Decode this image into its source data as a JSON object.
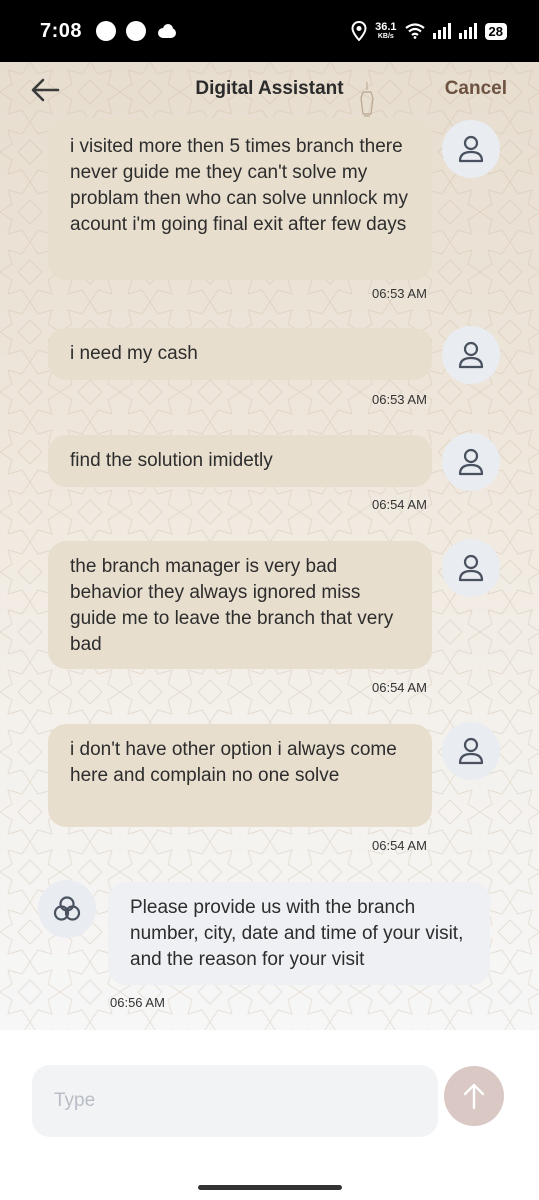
{
  "status_bar": {
    "time": "7:08",
    "speed_value": "36.1",
    "speed_unit": "KB/s",
    "battery": "28"
  },
  "header": {
    "title": "Digital Assistant",
    "cancel_label": "Cancel"
  },
  "messages": [
    {
      "sender": "user",
      "text": "i visited more then 5 times branch there never guide me they can't solve my problam then who can solve unnlock my acount i'm going final exit after few days",
      "time": "06:53 AM"
    },
    {
      "sender": "user",
      "text": "i need my cash",
      "time": "06:53 AM"
    },
    {
      "sender": "user",
      "text": "find the solution imidetly",
      "time": "06:54 AM"
    },
    {
      "sender": "user",
      "text": "the branch manager is very bad behavior they always ignored miss guide me to leave the branch that very bad",
      "time": "06:54 AM"
    },
    {
      "sender": "user",
      "text": "i don't have other option i always come here and complain no one solve",
      "time": "06:54 AM"
    },
    {
      "sender": "assistant",
      "text": "Please provide us with the branch number, city, date and time of your visit, and the reason for your visit",
      "time": "06:56 AM"
    }
  ],
  "composer": {
    "placeholder": "Type",
    "value": ""
  },
  "colors": {
    "user_bubble": "#e8dece",
    "bot_bubble": "#eef0f4",
    "cancel": "#6e5240",
    "send_button": "#d9c8c4"
  }
}
